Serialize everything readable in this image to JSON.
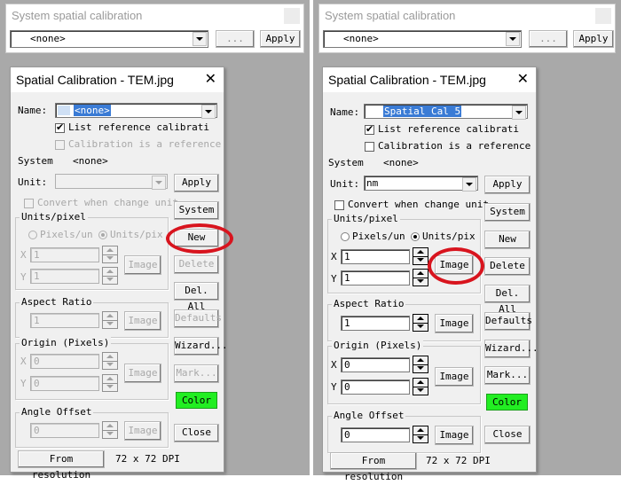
{
  "panels": [
    {
      "system_bar": {
        "title": "System spatial calibration",
        "value": "<none>",
        "browse_label": "...",
        "apply_label": "Apply"
      },
      "dialog": {
        "title": "Spatial Calibration - TEM.jpg",
        "close_glyph": "✕",
        "name_label": "Name:",
        "name_value": "<none>",
        "list_reference_label": "List reference calibrati",
        "list_reference_checked": true,
        "calibration_reference_label": "Calibration is a reference",
        "calibration_reference_checked": false,
        "system_label": "System",
        "system_value": "<none>",
        "unit_label": "Unit:",
        "unit_value": "",
        "convert_label": "Convert when change unit",
        "units_pixel": {
          "title": "Units/pixel",
          "radio_pixels": "Pixels/un",
          "radio_units": "Units/pix",
          "selected": "Units/pix",
          "x_label": "X",
          "x_value": "1",
          "y_label": "Y",
          "y_value": "1",
          "image_label": "Image"
        },
        "aspect_ratio": {
          "title": "Aspect Ratio",
          "value": "1",
          "image_label": "Image"
        },
        "origin": {
          "title": "Origin (Pixels)",
          "x_label": "X",
          "x_value": "0",
          "y_label": "Y",
          "y_value": "0",
          "image_label": "Image"
        },
        "angle_offset": {
          "title": "Angle Offset",
          "value": "0",
          "image_label": "Image"
        },
        "from_resolution_label": "From resolution",
        "resolution_text": "72 x 72 DPI",
        "side_buttons": {
          "apply": "Apply",
          "system": "System",
          "new": "New",
          "delete": "Delete",
          "del_all": "Del. All",
          "defaults": "Defaults",
          "wizard": "Wizard...",
          "mark": "Mark...",
          "color": "Color",
          "close": "Close"
        },
        "highlight": "New button circled in red"
      }
    },
    {
      "system_bar": {
        "title": "System spatial calibration",
        "value": "<none>",
        "browse_label": "...",
        "apply_label": "Apply"
      },
      "dialog": {
        "title": "Spatial Calibration - TEM.jpg",
        "close_glyph": "✕",
        "name_label": "Name:",
        "name_value": "Spatial Cal 5",
        "list_reference_label": "List reference calibrati",
        "list_reference_checked": true,
        "calibration_reference_label": "Calibration is a reference",
        "calibration_reference_checked": false,
        "system_label": "System",
        "system_value": "<none>",
        "unit_label": "Unit:",
        "unit_value": "nm",
        "convert_label": "Convert when change unit",
        "units_pixel": {
          "title": "Units/pixel",
          "radio_pixels": "Pixels/un",
          "radio_units": "Units/pix",
          "selected": "Units/pix",
          "x_label": "X",
          "x_value": "1",
          "y_label": "Y",
          "y_value": "1",
          "image_label": "Image"
        },
        "aspect_ratio": {
          "title": "Aspect Ratio",
          "value": "1",
          "image_label": "Image"
        },
        "origin": {
          "title": "Origin (Pixels)",
          "x_label": "X",
          "x_value": "0",
          "y_label": "Y",
          "y_value": "0",
          "image_label": "Image"
        },
        "angle_offset": {
          "title": "Angle Offset",
          "value": "0",
          "image_label": "Image"
        },
        "from_resolution_label": "From resolution",
        "resolution_text": "72 x 72 DPI",
        "side_buttons": {
          "apply": "Apply",
          "system": "System",
          "new": "New",
          "delete": "Delete",
          "del_all": "Del. All",
          "defaults": "Defaults",
          "wizard": "Wizard...",
          "mark": "Mark...",
          "color": "Color",
          "close": "Close"
        },
        "highlight": "Image button circled in red"
      }
    }
  ],
  "colors": {
    "color_button": "#22ee22",
    "highlight_circle": "#d8141e",
    "selection": "#3a7bd5"
  }
}
